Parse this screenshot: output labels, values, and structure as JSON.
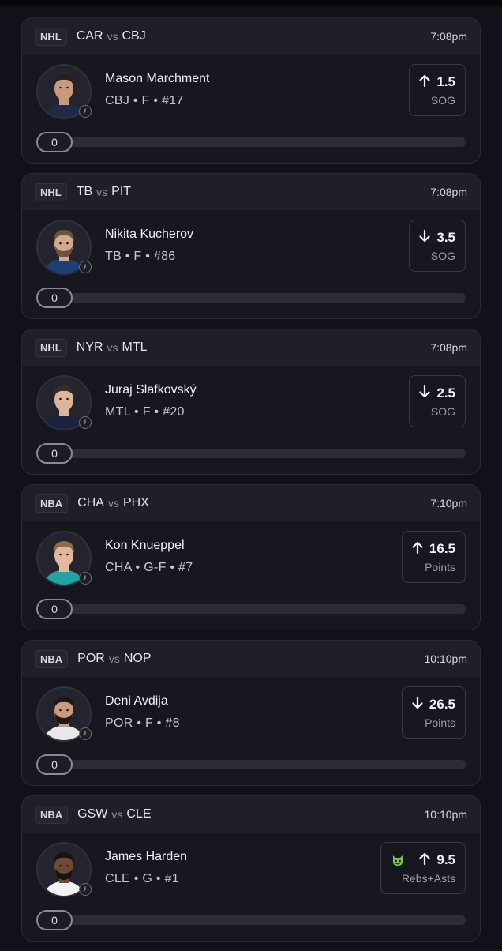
{
  "colors": {
    "background": "#111119",
    "card": "#17171f",
    "card_header": "#1f1f29",
    "progress_track": "#2c2c36",
    "demon_green": "#79c35b"
  },
  "icons": {
    "up": "arrow-up-icon",
    "down": "arrow-down-icon",
    "clock": "clock-icon",
    "demon": "demon-icon",
    "avatar": "player-headshot"
  },
  "vs_label": "vs",
  "picks": [
    {
      "league": "NHL",
      "home": "CAR",
      "away": "CBJ",
      "time": "7:08pm",
      "player": "Mason Marchment",
      "info": "CBJ • F • #17",
      "direction": "up",
      "line": "1.5",
      "stat": "SOG",
      "progress": 0,
      "demon": false,
      "skin": "#c99a7e",
      "hair": "#2a1e18",
      "jersey": "#1f2a44",
      "beard": false
    },
    {
      "league": "NHL",
      "home": "TB",
      "away": "PIT",
      "time": "7:08pm",
      "player": "Nikita Kucherov",
      "info": "TB • F • #86",
      "direction": "down",
      "line": "3.5",
      "stat": "SOG",
      "progress": 0,
      "demon": false,
      "skin": "#d2a98d",
      "hair": "#6b5540",
      "jersey": "#1d3f7a",
      "beard": true
    },
    {
      "league": "NHL",
      "home": "NYR",
      "away": "MTL",
      "time": "7:08pm",
      "player": "Juraj Slafkovský",
      "info": "MTL • F • #20",
      "direction": "down",
      "line": "2.5",
      "stat": "SOG",
      "progress": 0,
      "demon": false,
      "skin": "#dcb59c",
      "hair": "#3a2a20",
      "jersey": "#1b2340",
      "beard": false
    },
    {
      "league": "NBA",
      "home": "CHA",
      "away": "PHX",
      "time": "7:10pm",
      "player": "Kon Knueppel",
      "info": "CHA • G-F • #7",
      "direction": "up",
      "line": "16.5",
      "stat": "Points",
      "progress": 0,
      "demon": false,
      "skin": "#e2b79a",
      "hair": "#8a6a48",
      "jersey": "#21a3a3",
      "beard": false
    },
    {
      "league": "NBA",
      "home": "POR",
      "away": "NOP",
      "time": "10:10pm",
      "player": "Deni Avdija",
      "info": "POR • F • #8",
      "direction": "down",
      "line": "26.5",
      "stat": "Points",
      "progress": 0,
      "demon": false,
      "skin": "#c99b7c",
      "hair": "#1f1813",
      "jersey": "#e8e8ea",
      "beard": true
    },
    {
      "league": "NBA",
      "home": "GSW",
      "away": "CLE",
      "time": "10:10pm",
      "player": "James Harden",
      "info": "CLE • G • #1",
      "direction": "up",
      "line": "9.5",
      "stat": "Rebs+Asts",
      "progress": 0,
      "demon": true,
      "skin": "#6f4a35",
      "hair": "#1a1310",
      "jersey": "#f2f2f2",
      "beard": true
    }
  ]
}
